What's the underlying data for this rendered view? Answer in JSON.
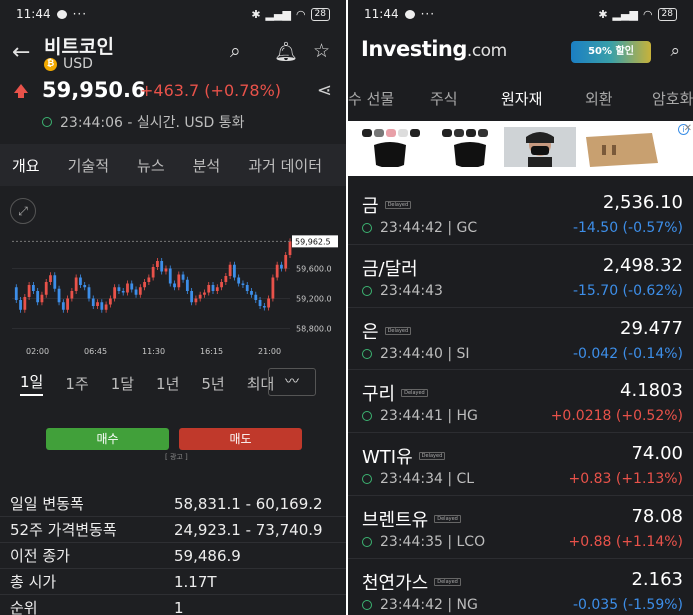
{
  "left": {
    "status": {
      "time": "11:44",
      "dots": "···",
      "battery": "28"
    },
    "header": {
      "title": "비트코인",
      "currency": "USD"
    },
    "quote": {
      "price": "59,950.6",
      "change": "+463.7 (+0.78%)",
      "time": "23:44:06 - 실시간. USD 통화"
    },
    "tabs": [
      "개요",
      "기술적",
      "뉴스",
      "분석",
      "과거 데이터"
    ],
    "chart_data": {
      "type": "line",
      "x_ticks": [
        "02:00",
        "06:45",
        "11:30",
        "16:15",
        "21:00"
      ],
      "y_ticks": [
        "59,600.0",
        "59,200.0",
        "58,800.0"
      ],
      "last_label": "59,962.5",
      "ylim": [
        58700,
        60100
      ],
      "y": [
        59350,
        59180,
        59050,
        59220,
        59380,
        59300,
        59150,
        59250,
        59420,
        59510,
        59330,
        59150,
        59050,
        59200,
        59300,
        59480,
        59380,
        59350,
        59200,
        59100,
        59150,
        59050,
        59120,
        59200,
        59350,
        59300,
        59280,
        59400,
        59320,
        59250,
        59350,
        59420,
        59480,
        59620,
        59700,
        59560,
        59600,
        59400,
        59350,
        59520,
        59450,
        59300,
        59150,
        59200,
        59250,
        59280,
        59380,
        59300,
        59350,
        59420,
        59500,
        59650,
        59480,
        59400,
        59380,
        59300,
        59250,
        59180,
        59100,
        59080,
        59200,
        59480,
        59650,
        59600,
        59780,
        59962
      ]
    },
    "periods": [
      "1일",
      "1주",
      "1달",
      "1년",
      "5년",
      "최대"
    ],
    "chart_type_icon": "line-chart-icon",
    "buy_label": "매수",
    "sell_label": "매도",
    "ad_label": "[ 광고 ]",
    "stats": [
      {
        "k": "일일 변동폭",
        "v": "58,831.1 - 60,169.2"
      },
      {
        "k": "52주 가격변동폭",
        "v": "24,923.1 - 73,740.9"
      },
      {
        "k": "이전 종가",
        "v": "59,486.9"
      },
      {
        "k": "총 시가",
        "v": "1.17T"
      },
      {
        "k": "순위",
        "v": "1"
      }
    ],
    "colors": {
      "up": "#e8524a",
      "down": "#3d8ee8",
      "buy": "#41a03a",
      "sell": "#c0392b"
    }
  },
  "right": {
    "status": {
      "time": "11:44",
      "dots": "···",
      "battery": "28"
    },
    "logo": "Investing",
    "logo_suffix": ".com",
    "promo": "50% 할인",
    "tabs": [
      "수 선물",
      "주식",
      "원자재",
      "외환",
      "암호화"
    ],
    "commodities": [
      {
        "name": "금",
        "delayed": "Delayed",
        "price": "2,536.10",
        "time": "23:44:42 | GC",
        "change": "-14.50 (-0.57%)",
        "dir": "neg"
      },
      {
        "name": "금/달러",
        "delayed": "",
        "price": "2,498.32",
        "time": "23:44:43",
        "change": "-15.70 (-0.62%)",
        "dir": "neg"
      },
      {
        "name": "은",
        "delayed": "Delayed",
        "price": "29.477",
        "time": "23:44:40 | SI",
        "change": "-0.042 (-0.14%)",
        "dir": "neg"
      },
      {
        "name": "구리",
        "delayed": "Delayed",
        "price": "4.1803",
        "time": "23:44:41 | HG",
        "change": "+0.0218 (+0.52%)",
        "dir": "pos"
      },
      {
        "name": "WTI유",
        "delayed": "Delayed",
        "price": "74.00",
        "time": "23:44:34 | CL",
        "change": "+0.83 (+1.13%)",
        "dir": "pos"
      },
      {
        "name": "브렌트유",
        "delayed": "Delayed",
        "price": "78.08",
        "time": "23:44:35 | LCO",
        "change": "+0.88 (+1.14%)",
        "dir": "pos"
      },
      {
        "name": "천연가스",
        "delayed": "Delayed",
        "price": "2.163",
        "time": "23:44:42 | NG",
        "change": "-0.035 (-1.59%)",
        "dir": "neg"
      }
    ]
  }
}
